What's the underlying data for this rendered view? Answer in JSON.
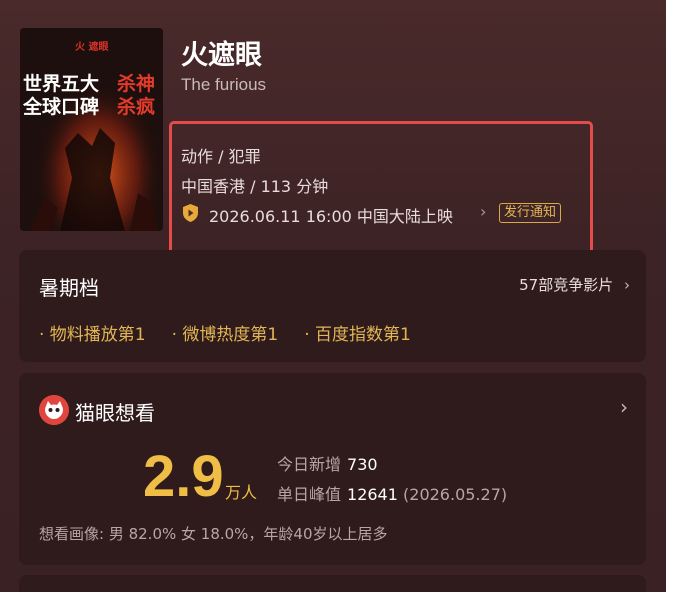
{
  "movie": {
    "title": "火遮眼",
    "subtitle": "The furious",
    "genre": "动作 / 犯罪",
    "region_duration": "中国香港 / 113 分钟",
    "release": "2026.06.11 16:00 中国大陆上映",
    "notify_label": "发行通知"
  },
  "poster": {
    "logo_text": "火 遮眼",
    "line1_a": "世界五大",
    "line1_b": "杀神",
    "line2_a": "全球口碑",
    "line2_b": "杀疯"
  },
  "summer": {
    "title": "暑期档",
    "compete": "57部竞争影片",
    "tags": [
      "· 物料播放第1",
      "· 微博热度第1",
      "· 百度指数第1"
    ]
  },
  "want": {
    "title": "猫眼想看",
    "count": "2.9",
    "unit": "万人",
    "today_label": "今日新增",
    "today_value": "730",
    "peak_label": "单日峰值",
    "peak_value": "12641",
    "peak_date": "(2026.05.27)",
    "portrait": "想看画像: 男 82.0%  女 18.0%，年龄40岁以上居多"
  },
  "colors": {
    "accent_gold": "#f0bd46",
    "highlight_red": "#e44b4b",
    "icon_red": "#e0463d"
  }
}
